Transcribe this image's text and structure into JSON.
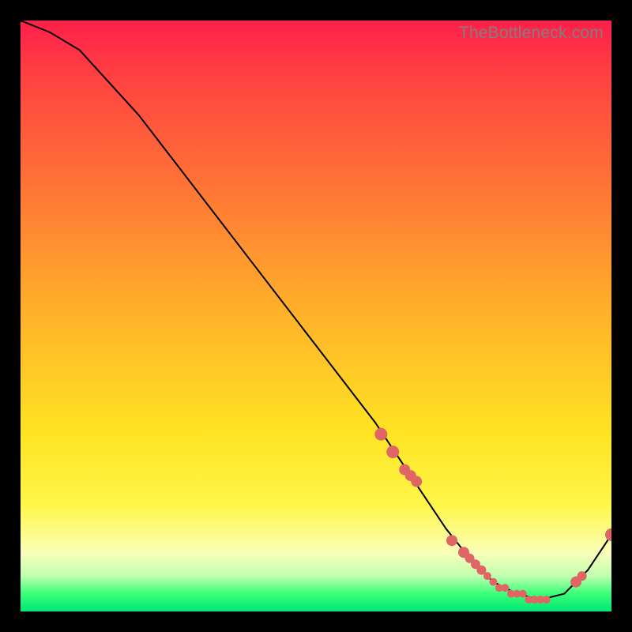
{
  "watermark": "TheBottleneck.com",
  "colors": {
    "marker": "#e06666",
    "line": "#000000",
    "gradient_stops": [
      "#ff1f4b",
      "#ff4340",
      "#ff7a35",
      "#ffb329",
      "#ffe423",
      "#fff64a",
      "#faffb8",
      "#bfffb0",
      "#3bff77",
      "#00e676"
    ]
  },
  "chart_data": {
    "type": "line",
    "title": "",
    "xlabel": "",
    "ylabel": "",
    "xlim": [
      0,
      100
    ],
    "ylim": [
      0,
      100
    ],
    "series": [
      {
        "name": "curve",
        "x": [
          0,
          5,
          10,
          20,
          30,
          40,
          50,
          60,
          68,
          72,
          76,
          80,
          84,
          88,
          92,
          96,
          100
        ],
        "values": [
          100,
          98,
          95,
          84,
          71,
          58,
          45,
          32,
          20,
          14,
          9,
          5,
          3,
          2,
          3,
          7,
          13
        ]
      }
    ],
    "markers": {
      "name": "highlighted-points",
      "x": [
        61,
        63,
        65,
        66,
        67,
        73,
        75,
        76,
        77,
        78,
        79,
        80,
        81,
        82,
        83,
        84,
        85,
        86,
        87,
        88,
        89,
        94,
        95,
        100
      ],
      "values": [
        30,
        27,
        24,
        23,
        22,
        12,
        10,
        9,
        8,
        7,
        6,
        5,
        4,
        4,
        3,
        3,
        3,
        2,
        2,
        2,
        2,
        5,
        6,
        13
      ],
      "size": [
        8,
        8,
        7,
        7,
        7,
        7,
        7,
        6,
        6,
        6,
        5,
        5,
        5,
        5,
        5,
        5,
        5,
        5,
        5,
        5,
        5,
        7,
        6,
        8
      ]
    }
  }
}
